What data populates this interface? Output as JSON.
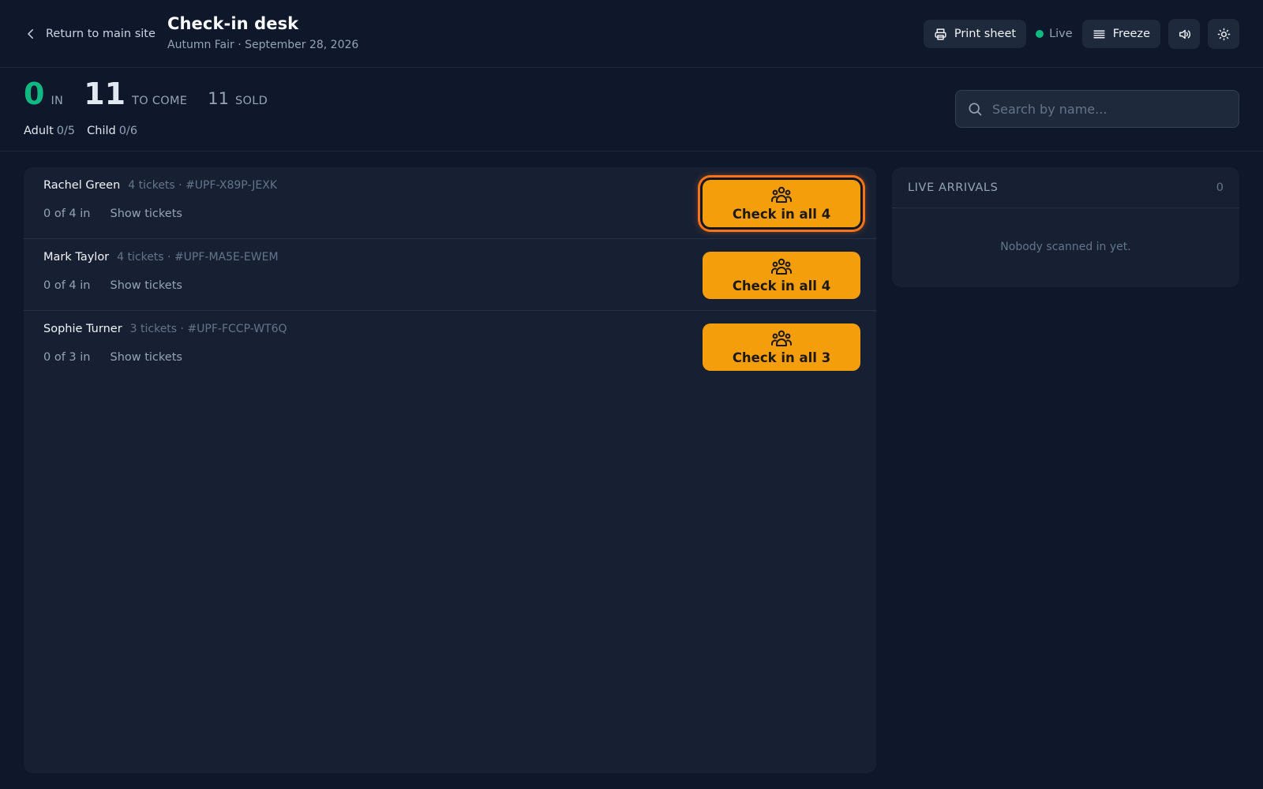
{
  "header": {
    "back_label": "Return to main site",
    "title": "Check-in desk",
    "subtitle": "Autumn Fair · September 28, 2026",
    "print_label": "Print sheet",
    "live_label": "Live",
    "freeze_label": "Freeze"
  },
  "stats": {
    "in_value": "0",
    "in_label": "IN",
    "to_come_value": "11",
    "to_come_label": "TO COME",
    "sold_value": "11",
    "sold_label": "SOLD",
    "breakdown": [
      {
        "label": "Adult",
        "value": "0/5"
      },
      {
        "label": "Child",
        "value": "0/6"
      }
    ]
  },
  "search": {
    "placeholder": "Search by name..."
  },
  "orders": [
    {
      "name": "Rachel Green",
      "meta": "4 tickets · #UPF-X89P-JEXK",
      "count": "0 of 4 in",
      "show_label": "Show tickets",
      "button_label": "Check in all 4"
    },
    {
      "name": "Mark Taylor",
      "meta": "4 tickets · #UPF-MA5E-EWEM",
      "count": "0 of 4 in",
      "show_label": "Show tickets",
      "button_label": "Check in all 4"
    },
    {
      "name": "Sophie Turner",
      "meta": "3 tickets · #UPF-FCCP-WT6Q",
      "count": "0 of 3 in",
      "show_label": "Show tickets",
      "button_label": "Check in all 3"
    }
  ],
  "arrivals": {
    "title": "LIVE ARRIVALS",
    "count": "0",
    "empty_text": "Nobody scanned in yet."
  },
  "colors": {
    "background": "#0f172a",
    "panel": "#172033",
    "accent": "#f59e0b",
    "focus_ring": "#f97316",
    "live": "#10b981",
    "in_count": "#10b981"
  }
}
